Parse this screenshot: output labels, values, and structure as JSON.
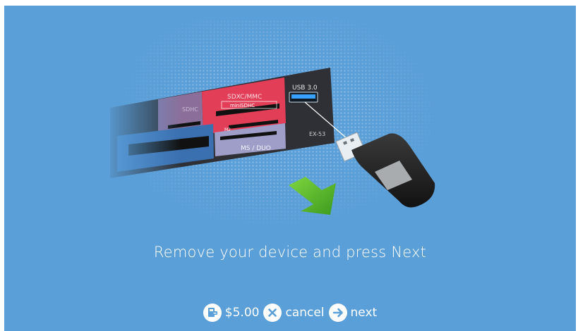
{
  "reader": {
    "label_sdhc": "SDHC",
    "label_sdxc": "SDXC/MMC",
    "label_minisd": "miniSDHC",
    "label_m2": "M2",
    "label_msduo": "MS / DUO",
    "label_usb": "USB 3.0",
    "label_model": "EX-53"
  },
  "message": "Remove your device and press Next",
  "bottom_bar": {
    "price": "$5.00",
    "cancel_label": "cancel",
    "next_label": "next"
  },
  "icons": {
    "price": "card-reader-icon",
    "cancel": "x-circle-icon",
    "next": "arrow-right-circle-icon",
    "arrow": "green-arrow-down-icon"
  },
  "colors": {
    "background": "#5b9fd8",
    "sdxc_slot": "#e23e57",
    "msduo_slot": "#9e9ec9",
    "usb_port": "#3aa0ff",
    "arrow": "#5ab62c"
  }
}
